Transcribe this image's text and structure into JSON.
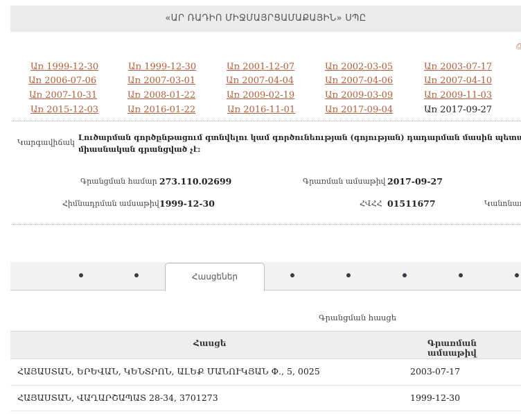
{
  "header": {
    "title": "«ԱՐ ՌԱԴԻՈ ՄԻՋՄԱՅՐՑԱՄԱՔԱՅԻՆ» ՍՊԸ"
  },
  "dates": {
    "row1": [
      "Առ 1999-12-30",
      "Առ 1999-12-30",
      "Առ 2001-12-07",
      "Առ 2002-03-05",
      "Առ 2003-07-17"
    ],
    "row2": [
      "Առ 2006-07-06",
      "Առ 2007-03-01",
      "Առ 2007-04-04",
      "Առ 2007-04-06",
      "Առ 2007-04-10"
    ],
    "row3": [
      "Առ 2007-10-31",
      "Առ 2008-01-22",
      "Առ 2009-02-19",
      "Առ 2009-03-09",
      "Առ 2009-11-03"
    ],
    "row4": [
      "Առ 2015-12-03",
      "Առ 2016-01-22",
      "Առ 2016-11-01",
      "Առ 2017-09-04",
      "Առ 2017-09-27"
    ]
  },
  "info": {
    "status_label": "Կարգավիճակ",
    "status_text": "Լուծարման գործընթացում գտնվելու կամ գործունեության (գոյության) դադարման մասին պետական միասնական գրանցված չէ:",
    "reg_number_label": "Գրանցման համար",
    "reg_number": "273.110.02699",
    "record_date_label": "Գրառման ամսաթիվ",
    "record_date": "2017-09-27",
    "founding_date_label": "Հիմնադրման ամսաթիվ",
    "founding_date": "1999-12-30",
    "tin_label": "ՀՎՀՀ",
    "tin": "01511677",
    "truncated_label": "Կանոնադ"
  },
  "tabs": {
    "active_label": "Հասցեներ"
  },
  "addresses": {
    "caption": "Գրանցման հասցե",
    "columns": [
      "Հասցե",
      "Գրառման ամսաթիվ"
    ],
    "rows": [
      {
        "address": "ՀԱՅԱՍՏԱՆ, ԵՐԵՎԱՆ, ԿԵՆՏՐՈՆ, ԱԼԵՔ ՄԱՆՈՒԿՅԱՆ Փ., 5, 0025",
        "date": "2003-07-17"
      },
      {
        "address": "ՀԱՅԱՍՏԱՆ, ՎԱՂԱՐՇԱՊԱՏ 28-34, 3701273",
        "date": "1999-12-30"
      }
    ]
  }
}
